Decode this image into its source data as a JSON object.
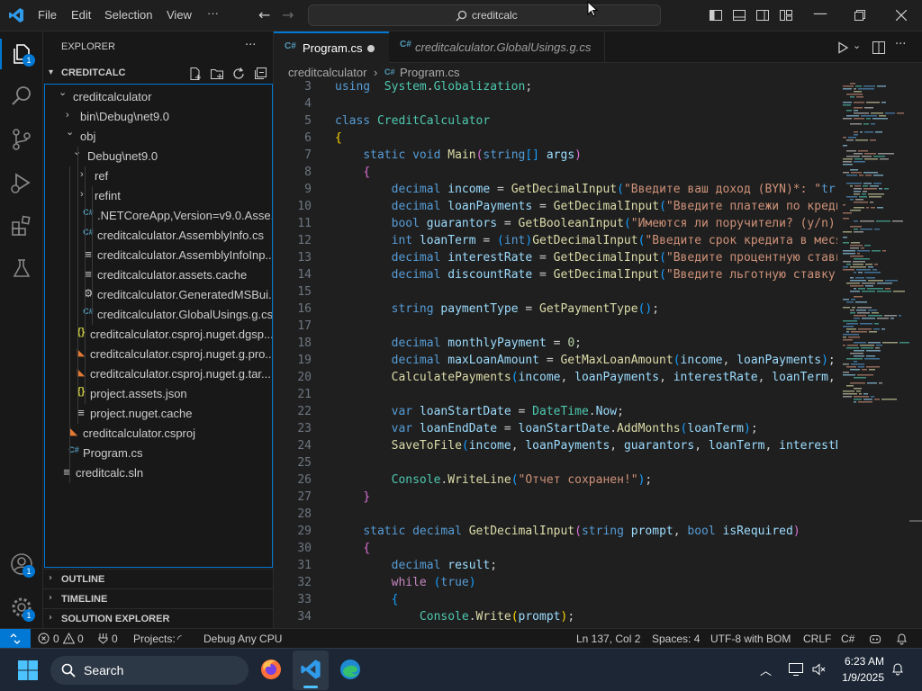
{
  "titlebar": {
    "menus": [
      "File",
      "Edit",
      "Selection",
      "View"
    ],
    "more": "···",
    "search_text": "creditcalc"
  },
  "activity": {
    "explorer_badge": "1",
    "accounts_badge": "1",
    "manage_badge": "1"
  },
  "sidebar": {
    "title": "EXPLORER",
    "more": "···",
    "root": "CREDITCALC",
    "tree": [
      {
        "label": "creditcalculator",
        "depth": 1,
        "chevron": "down",
        "icon": ""
      },
      {
        "label": "bin\\Debug\\net9.0",
        "depth": 2,
        "chevron": "right",
        "icon": ""
      },
      {
        "label": "obj",
        "depth": 2,
        "chevron": "down",
        "icon": ""
      },
      {
        "label": "Debug\\net9.0",
        "depth": 3,
        "chevron": "down",
        "icon": ""
      },
      {
        "label": "ref",
        "depth": 4,
        "chevron": "right",
        "icon": ""
      },
      {
        "label": "refint",
        "depth": 4,
        "chevron": "right",
        "icon": ""
      },
      {
        "label": ".NETCoreApp,Version=v9.0.Asse...",
        "depth": 4,
        "chevron": "",
        "icon": "cs"
      },
      {
        "label": "creditcalculator.AssemblyInfo.cs",
        "depth": 4,
        "chevron": "",
        "icon": "cs"
      },
      {
        "label": "creditcalculator.AssemblyInfoInp...",
        "depth": 4,
        "chevron": "",
        "icon": "lines"
      },
      {
        "label": "creditcalculator.assets.cache",
        "depth": 4,
        "chevron": "",
        "icon": "lines"
      },
      {
        "label": "creditcalculator.GeneratedMSBui...",
        "depth": 4,
        "chevron": "",
        "icon": "gear"
      },
      {
        "label": "creditcalculator.GlobalUsings.g.cs",
        "depth": 4,
        "chevron": "",
        "icon": "cs"
      },
      {
        "label": "creditcalculator.csproj.nuget.dgsp...",
        "depth": 3,
        "chevron": "",
        "icon": "json"
      },
      {
        "label": "creditcalculator.csproj.nuget.g.pro...",
        "depth": 3,
        "chevron": "",
        "icon": "rss"
      },
      {
        "label": "creditcalculator.csproj.nuget.g.tar...",
        "depth": 3,
        "chevron": "",
        "icon": "rss"
      },
      {
        "label": "project.assets.json",
        "depth": 3,
        "chevron": "",
        "icon": "json"
      },
      {
        "label": "project.nuget.cache",
        "depth": 3,
        "chevron": "",
        "icon": "lines"
      },
      {
        "label": "creditcalculator.csproj",
        "depth": 2,
        "chevron": "",
        "icon": "rss"
      },
      {
        "label": "Program.cs",
        "depth": 2,
        "chevron": "",
        "icon": "cs"
      },
      {
        "label": "creditcalc.sln",
        "depth": 1,
        "chevron": "",
        "icon": "lines"
      }
    ],
    "sections": [
      "OUTLINE",
      "TIMELINE",
      "SOLUTION EXPLORER"
    ]
  },
  "tabs": [
    {
      "label": "Program.cs",
      "active": true,
      "modified": true
    },
    {
      "label": "creditcalculator.GlobalUsings.g.cs",
      "active": false,
      "modified": false
    }
  ],
  "breadcrumb": [
    "creditcalculator",
    "Program.cs"
  ],
  "code_lines": [
    {
      "n": "3",
      "tokens": [
        [
          "kw",
          "using"
        ],
        [
          "",
          "  "
        ],
        [
          "ty",
          "System"
        ],
        [
          "",
          "."
        ],
        [
          "ty",
          "Globalization"
        ],
        [
          "",
          ";"
        ]
      ]
    },
    {
      "n": "4",
      "tokens": []
    },
    {
      "n": "5",
      "tokens": [
        [
          "kw",
          "class"
        ],
        [
          "",
          " "
        ],
        [
          "ty",
          "CreditCalculator"
        ]
      ]
    },
    {
      "n": "6",
      "tokens": [
        [
          "br1",
          "{"
        ]
      ]
    },
    {
      "n": "7",
      "tokens": [
        [
          "",
          "    "
        ],
        [
          "kw",
          "static"
        ],
        [
          "",
          " "
        ],
        [
          "kw",
          "void"
        ],
        [
          "",
          " "
        ],
        [
          "fn",
          "Main"
        ],
        [
          "br2",
          "("
        ],
        [
          "kw",
          "string"
        ],
        [
          "br3",
          "[]"
        ],
        [
          "",
          " "
        ],
        [
          "var",
          "args"
        ],
        [
          "br2",
          ")"
        ]
      ]
    },
    {
      "n": "8",
      "tokens": [
        [
          "",
          "    "
        ],
        [
          "br2",
          "{"
        ]
      ]
    },
    {
      "n": "9",
      "tokens": [
        [
          "",
          "        "
        ],
        [
          "kw",
          "decimal"
        ],
        [
          "",
          " "
        ],
        [
          "var",
          "income"
        ],
        [
          "",
          " = "
        ],
        [
          "fn",
          "GetDecimalInput"
        ],
        [
          "br3",
          "("
        ],
        [
          "str",
          "\"Введите ваш доход (BYN)*: \""
        ],
        [
          ", "
        ],
        [
          "kw",
          "tr"
        ]
      ]
    },
    {
      "n": "10",
      "tokens": [
        [
          "",
          "        "
        ],
        [
          "kw",
          "decimal"
        ],
        [
          "",
          " "
        ],
        [
          "var",
          "loanPayments"
        ],
        [
          "",
          " = "
        ],
        [
          "fn",
          "GetDecimalInput"
        ],
        [
          "br3",
          "("
        ],
        [
          "str",
          "\"Введите платежи по креди"
        ]
      ]
    },
    {
      "n": "11",
      "tokens": [
        [
          "",
          "        "
        ],
        [
          "kw",
          "bool"
        ],
        [
          "",
          " "
        ],
        [
          "var",
          "guarantors"
        ],
        [
          "",
          " = "
        ],
        [
          "fn",
          "GetBooleanInput"
        ],
        [
          "br3",
          "("
        ],
        [
          "str",
          "\"Имеются ли поручители? (y/n):"
        ]
      ]
    },
    {
      "n": "12",
      "tokens": [
        [
          "",
          "        "
        ],
        [
          "kw",
          "int"
        ],
        [
          "",
          " "
        ],
        [
          "var",
          "loanTerm"
        ],
        [
          "",
          " = "
        ],
        [
          "br3",
          "("
        ],
        [
          "kw",
          "int"
        ],
        [
          "br3",
          ")"
        ],
        [
          "fn",
          "GetDecimalInput"
        ],
        [
          "br3",
          "("
        ],
        [
          "str",
          "\"Введите срок кредита в меся"
        ]
      ]
    },
    {
      "n": "13",
      "tokens": [
        [
          "",
          "        "
        ],
        [
          "kw",
          "decimal"
        ],
        [
          "",
          " "
        ],
        [
          "var",
          "interestRate"
        ],
        [
          "",
          " = "
        ],
        [
          "fn",
          "GetDecimalInput"
        ],
        [
          "br3",
          "("
        ],
        [
          "str",
          "\"Введите процентную ставку"
        ]
      ]
    },
    {
      "n": "14",
      "tokens": [
        [
          "",
          "        "
        ],
        [
          "kw",
          "decimal"
        ],
        [
          "",
          " "
        ],
        [
          "var",
          "discountRate"
        ],
        [
          "",
          " = "
        ],
        [
          "fn",
          "GetDecimalInput"
        ],
        [
          "br3",
          "("
        ],
        [
          "str",
          "\"Введите льготную ставку"
        ]
      ]
    },
    {
      "n": "15",
      "tokens": []
    },
    {
      "n": "16",
      "tokens": [
        [
          "",
          "        "
        ],
        [
          "kw",
          "string"
        ],
        [
          "",
          " "
        ],
        [
          "var",
          "paymentType"
        ],
        [
          "",
          " = "
        ],
        [
          "fn",
          "GetPaymentType"
        ],
        [
          "br3",
          "()"
        ],
        [
          "",
          ";"
        ]
      ]
    },
    {
      "n": "17",
      "tokens": []
    },
    {
      "n": "18",
      "tokens": [
        [
          "",
          "        "
        ],
        [
          "kw",
          "decimal"
        ],
        [
          "",
          " "
        ],
        [
          "var",
          "monthlyPayment"
        ],
        [
          "",
          " = "
        ],
        [
          "num",
          "0"
        ],
        [
          "",
          ";"
        ]
      ]
    },
    {
      "n": "19",
      "tokens": [
        [
          "",
          "        "
        ],
        [
          "kw",
          "decimal"
        ],
        [
          "",
          " "
        ],
        [
          "var",
          "maxLoanAmount"
        ],
        [
          "",
          " = "
        ],
        [
          "fn",
          "GetMaxLoanAmount"
        ],
        [
          "br3",
          "("
        ],
        [
          "var",
          "income"
        ],
        [
          "",
          ", "
        ],
        [
          "var",
          "loanPayments"
        ],
        [
          "br3",
          ")"
        ],
        [
          "",
          ";"
        ]
      ]
    },
    {
      "n": "20",
      "tokens": [
        [
          "",
          "        "
        ],
        [
          "fn",
          "CalculatePayments"
        ],
        [
          "br3",
          "("
        ],
        [
          "var",
          "income"
        ],
        [
          "",
          ", "
        ],
        [
          "var",
          "loanPayments"
        ],
        [
          "",
          ", "
        ],
        [
          "var",
          "interestRate"
        ],
        [
          "",
          ", "
        ],
        [
          "var",
          "loanTerm"
        ],
        [
          "",
          ", "
        ],
        [
          "var",
          "p"
        ]
      ]
    },
    {
      "n": "21",
      "tokens": []
    },
    {
      "n": "22",
      "tokens": [
        [
          "",
          "        "
        ],
        [
          "kw",
          "var"
        ],
        [
          "",
          " "
        ],
        [
          "var",
          "loanStartDate"
        ],
        [
          "",
          " = "
        ],
        [
          "ty",
          "DateTime"
        ],
        [
          "",
          "."
        ],
        [
          "var",
          "Now"
        ],
        [
          "",
          ";"
        ]
      ]
    },
    {
      "n": "23",
      "tokens": [
        [
          "",
          "        "
        ],
        [
          "kw",
          "var"
        ],
        [
          "",
          " "
        ],
        [
          "var",
          "loanEndDate"
        ],
        [
          "",
          " = "
        ],
        [
          "var",
          "loanStartDate"
        ],
        [
          "",
          "."
        ],
        [
          "fn",
          "AddMonths"
        ],
        [
          "br3",
          "("
        ],
        [
          "var",
          "loanTerm"
        ],
        [
          "br3",
          ")"
        ],
        [
          "",
          ";"
        ]
      ]
    },
    {
      "n": "24",
      "tokens": [
        [
          "",
          "        "
        ],
        [
          "fn",
          "SaveToFile"
        ],
        [
          "br3",
          "("
        ],
        [
          "var",
          "income"
        ],
        [
          "",
          ", "
        ],
        [
          "var",
          "loanPayments"
        ],
        [
          "",
          ", "
        ],
        [
          "var",
          "guarantors"
        ],
        [
          "",
          ", "
        ],
        [
          "var",
          "loanTerm"
        ],
        [
          "",
          ", "
        ],
        [
          "var",
          "interestRa"
        ]
      ]
    },
    {
      "n": "25",
      "tokens": []
    },
    {
      "n": "26",
      "tokens": [
        [
          "",
          "        "
        ],
        [
          "ty",
          "Console"
        ],
        [
          "",
          "."
        ],
        [
          "fn",
          "WriteLine"
        ],
        [
          "br3",
          "("
        ],
        [
          "str",
          "\"Отчет сохранен!\""
        ],
        [
          "br3",
          ")"
        ],
        [
          "",
          ";"
        ]
      ]
    },
    {
      "n": "27",
      "tokens": [
        [
          "",
          "    "
        ],
        [
          "br2",
          "}"
        ]
      ]
    },
    {
      "n": "28",
      "tokens": []
    },
    {
      "n": "29",
      "tokens": [
        [
          "",
          "    "
        ],
        [
          "kw",
          "static"
        ],
        [
          "",
          " "
        ],
        [
          "kw",
          "decimal"
        ],
        [
          "",
          " "
        ],
        [
          "fn",
          "GetDecimalInput"
        ],
        [
          "br2",
          "("
        ],
        [
          "kw",
          "string"
        ],
        [
          "",
          " "
        ],
        [
          "var",
          "prompt"
        ],
        [
          "",
          ", "
        ],
        [
          "kw",
          "bool"
        ],
        [
          "",
          " "
        ],
        [
          "var",
          "isRequired"
        ],
        [
          "br2",
          ")"
        ]
      ]
    },
    {
      "n": "30",
      "tokens": [
        [
          "",
          "    "
        ],
        [
          "br2",
          "{"
        ]
      ]
    },
    {
      "n": "31",
      "tokens": [
        [
          "",
          "        "
        ],
        [
          "kw",
          "decimal"
        ],
        [
          "",
          " "
        ],
        [
          "var",
          "result"
        ],
        [
          "",
          ";"
        ]
      ]
    },
    {
      "n": "32",
      "tokens": [
        [
          "",
          "        "
        ],
        [
          "ctl",
          "while"
        ],
        [
          "",
          " "
        ],
        [
          "br3",
          "("
        ],
        [
          "kw",
          "true"
        ],
        [
          "br3",
          ")"
        ]
      ]
    },
    {
      "n": "33",
      "tokens": [
        [
          "",
          "        "
        ],
        [
          "br3",
          "{"
        ]
      ]
    },
    {
      "n": "34",
      "tokens": [
        [
          "",
          "            "
        ],
        [
          "ty",
          "Console"
        ],
        [
          "",
          "."
        ],
        [
          "fn",
          "Write"
        ],
        [
          "br1",
          "("
        ],
        [
          "var",
          "prompt"
        ],
        [
          "br1",
          ")"
        ],
        [
          "",
          ";"
        ]
      ]
    }
  ],
  "status": {
    "errors": "0",
    "warnings": "0",
    "ports": "0",
    "projects": "Projects:",
    "config": "Debug Any CPU",
    "position": "Ln 137, Col 2",
    "spaces": "Spaces: 4",
    "encoding": "UTF-8 with BOM",
    "eol": "CRLF",
    "language": "C#"
  },
  "taskbar": {
    "search": "Search",
    "time": "6:23 AM",
    "date": "1/9/2025"
  },
  "colors": {
    "accent": "#0078d4",
    "editor_bg": "#1f1f1f",
    "sidebar_bg": "#181818"
  }
}
